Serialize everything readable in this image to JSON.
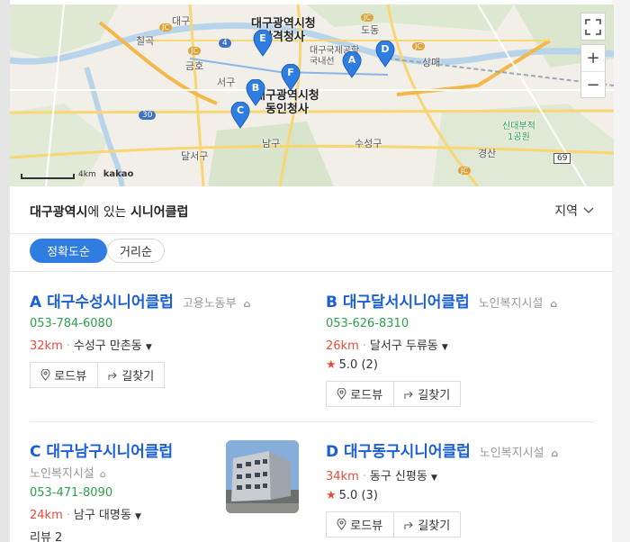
{
  "map": {
    "labels": {
      "daegu_city_hall_sanggyeok": "대구광역시청\n산격청사",
      "daegu_city_hall_dongin": "대구광역시청\n동인청사",
      "airport": "대구국제공항\n국내선",
      "chilgok": "칠곡",
      "geumho": "금호",
      "seogu": "서구",
      "dodong": "도동",
      "sangmae": "상매",
      "namgu": "남구",
      "suseonggu": "수성구",
      "dalseogu": "달서구",
      "gyeongsan": "경산",
      "sinmae_park": "신대부적\n1공원",
      "daegu_top": "대구",
      "route_4": "4",
      "route_30": "30",
      "route_69": "69",
      "jc_1": "JC",
      "jc_2": "JC",
      "jc_3": "JC",
      "jc_4": "JC",
      "jc_5": "JC"
    },
    "markers": [
      "A",
      "B",
      "C",
      "D",
      "E",
      "F"
    ],
    "scale_label": "4km",
    "logo": "kakao",
    "controls": {
      "fullscreen_icon": "fullscreen-icon",
      "zoom_in": "+",
      "zoom_out": "−"
    }
  },
  "header": {
    "title_region": "대구광역시",
    "title_mid": "에 있는 ",
    "title_keyword": "시니어클럽",
    "region_label": "지역"
  },
  "tabs": {
    "accuracy": "정확도순",
    "distance": "거리순"
  },
  "results": [
    {
      "letter": "A",
      "name_prefix": "대구수성",
      "name_highlight": "시니어클럽",
      "category": "고용노동부",
      "phone": "053-784-6080",
      "distance": "32km",
      "address": "수성구 만촌동",
      "rating": null,
      "reviews": null
    },
    {
      "letter": "B",
      "name_prefix": "대구달서",
      "name_highlight": "시니어클럽",
      "category": "노인복지시설",
      "phone": "053-626-8310",
      "distance": "26km",
      "address": "달서구 두류동",
      "rating": "5.0",
      "reviews": "(2)"
    },
    {
      "letter": "C",
      "name_prefix": "대구남구",
      "name_highlight": "시니어클럽",
      "category": "노인복지시설",
      "phone": "053-471-8090",
      "distance": "24km",
      "address": "남구 대명동",
      "rating": null,
      "review_text": "리뷰 2"
    },
    {
      "letter": "D",
      "name_prefix": "대구동구",
      "name_highlight": "시니어클럽",
      "category": "노인복지시설",
      "phone": null,
      "distance": "34km",
      "address": "동구 신평동",
      "rating": "5.0",
      "reviews": "(3)"
    }
  ],
  "buttons": {
    "roadview": "로드뷰",
    "directions": "길찾기"
  },
  "colors": {
    "accent": "#2f7de1",
    "link": "#1a5fd4",
    "phone": "#2ca04d",
    "distance": "#e94a3a"
  }
}
